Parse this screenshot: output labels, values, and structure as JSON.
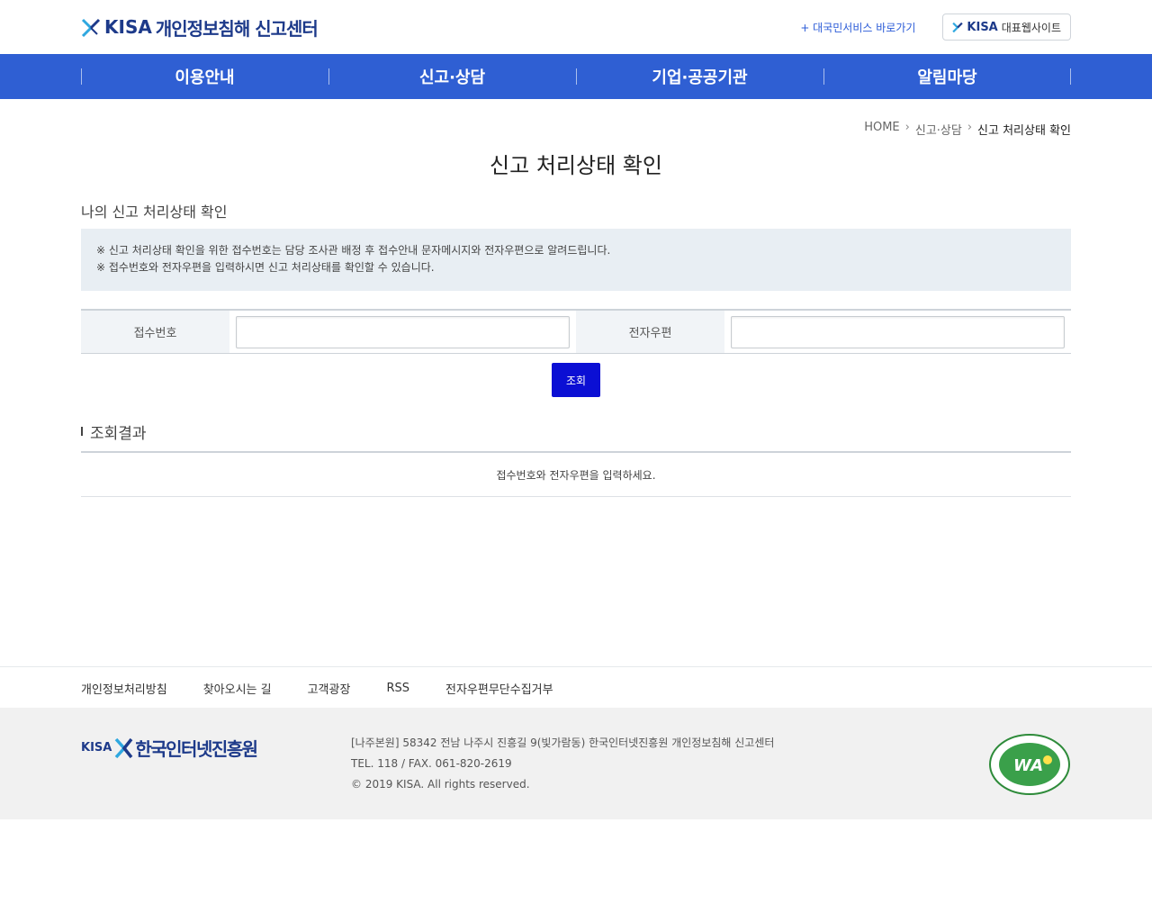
{
  "header": {
    "logo_kisa": "KISA",
    "logo_title": "개인정보침해 신고센터",
    "intl_link": "+ 대국민서비스 바로가기",
    "kisa_site_logo": "KISA",
    "kisa_site_label": "대표웹사이트"
  },
  "nav": {
    "items": [
      {
        "label": "이용안내"
      },
      {
        "label": "신고·상담"
      },
      {
        "label": "기업·공공기관"
      },
      {
        "label": "알림마당"
      }
    ]
  },
  "breadcrumb": {
    "home": "HOME",
    "level1": "신고·상담",
    "current": "신고 처리상태 확인"
  },
  "page": {
    "title": "신고 처리상태 확인",
    "subtitle": "나의 신고 처리상태 확인",
    "notice_lines": [
      "※ 신고 처리상태 확인을 위한 접수번호는 담당 조사관 배정 후 접수안내 문자메시지와 전자우편으로 알려드립니다.",
      "※ 접수번호와 전자우편을 입력하시면 신고 처리상태를 확인할 수 있습니다."
    ]
  },
  "form": {
    "receipt_label": "접수번호",
    "receipt_value": "",
    "email_label": "전자우편",
    "email_value": "",
    "search_button": "조회"
  },
  "result": {
    "title": "조회결과",
    "message": "접수번호와 전자우편을 입력하세요."
  },
  "footer": {
    "links": [
      {
        "label": "개인정보처리방침"
      },
      {
        "label": "찾아오시는 길"
      },
      {
        "label": "고객광장"
      },
      {
        "label": "RSS"
      },
      {
        "label": "전자우편무단수집거부"
      }
    ],
    "logo_kisa": "KISA",
    "logo_org": "한국인터넷진흥원",
    "address": "[나주본원] 58342 전남 나주시 진흥길 9(빛가람동) 한국인터넷진흥원 개인정보침해 신고센터",
    "contact": "TEL. 118 / FAX. 061-820-2619",
    "copyright": "© 2019 KISA. All rights reserved.",
    "badge_icon": "wa-web-accessibility-badge-icon"
  },
  "colors": {
    "nav_bg": "#2f5fd3",
    "search_button": "#0b0fd4",
    "brand": "#1d3a8a",
    "notice_bg": "#e8eef3"
  }
}
